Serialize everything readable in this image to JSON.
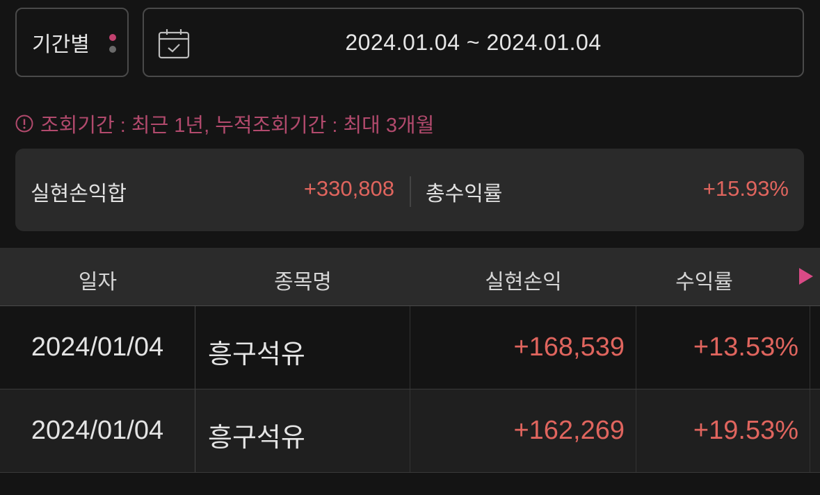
{
  "filter": {
    "period_label": "기간별",
    "date_range": "2024.01.04 ~ 2024.01.04"
  },
  "notice": "조회기간 : 최근 1년, 누적조회기간 : 최대 3개월",
  "summary": {
    "realized_pl_label": "실현손익합",
    "realized_pl_value": "+330,808",
    "total_return_label": "총수익률",
    "total_return_value": "+15.93%"
  },
  "table": {
    "headers": [
      "일자",
      "종목명",
      "실현손익",
      "수익률"
    ],
    "rows": [
      {
        "date": "2024/01/04",
        "name": "흥구석유",
        "pl": "+168,539",
        "rate": "+13.53%"
      },
      {
        "date": "2024/01/04",
        "name": "흥구석유",
        "pl": "+162,269",
        "rate": "+19.53%"
      }
    ]
  },
  "colors": {
    "accent": "#c2416f",
    "profit": "#e0655e",
    "background": "#141414",
    "panel": "#2a2a2a"
  },
  "icons": [
    "calendar-icon",
    "alert-circle-icon",
    "play-arrow-icon"
  ]
}
